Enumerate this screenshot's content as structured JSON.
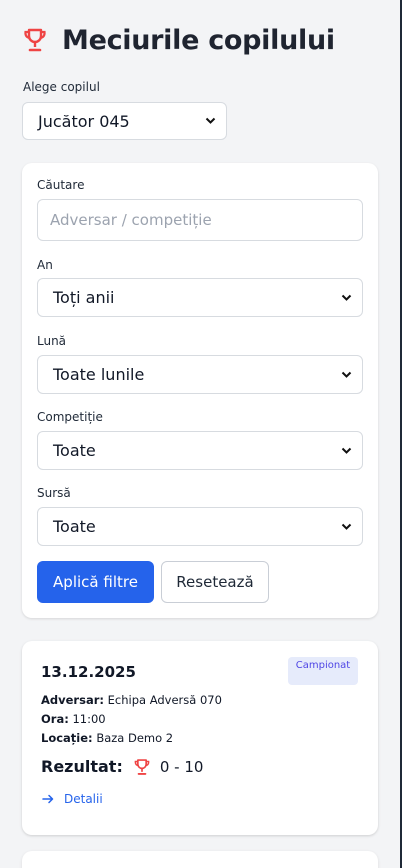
{
  "header": {
    "title": "Meciurile copilului",
    "icon": "trophy-icon",
    "icon_color": "#ef4444"
  },
  "child_select": {
    "label": "Alege copilul",
    "value": "Jucător 045"
  },
  "filters": {
    "search": {
      "label": "Căutare",
      "placeholder": "Adversar / competiție"
    },
    "year": {
      "label": "An",
      "value": "Toți anii"
    },
    "month": {
      "label": "Lună",
      "value": "Toate lunile"
    },
    "competition": {
      "label": "Competiție",
      "value": "Toate"
    },
    "source": {
      "label": "Sursă",
      "value": "Toate"
    },
    "apply_label": "Aplică filtre",
    "reset_label": "Resetează"
  },
  "match": {
    "date": "13.12.2025",
    "badge": "Campionat",
    "opponent_label": "Adversar:",
    "opponent": "Echipa Adversă 070",
    "time_label": "Ora:",
    "time": "11:00",
    "location_label": "Locație:",
    "location": "Baza Demo 2",
    "result_label": "Rezultat:",
    "score": "0 - 10",
    "details_label": "Detalii"
  },
  "colors": {
    "primary": "#2563eb",
    "background": "#f3f4f6",
    "badge_bg": "#e6ebfb",
    "badge_text": "#4f46e5"
  }
}
